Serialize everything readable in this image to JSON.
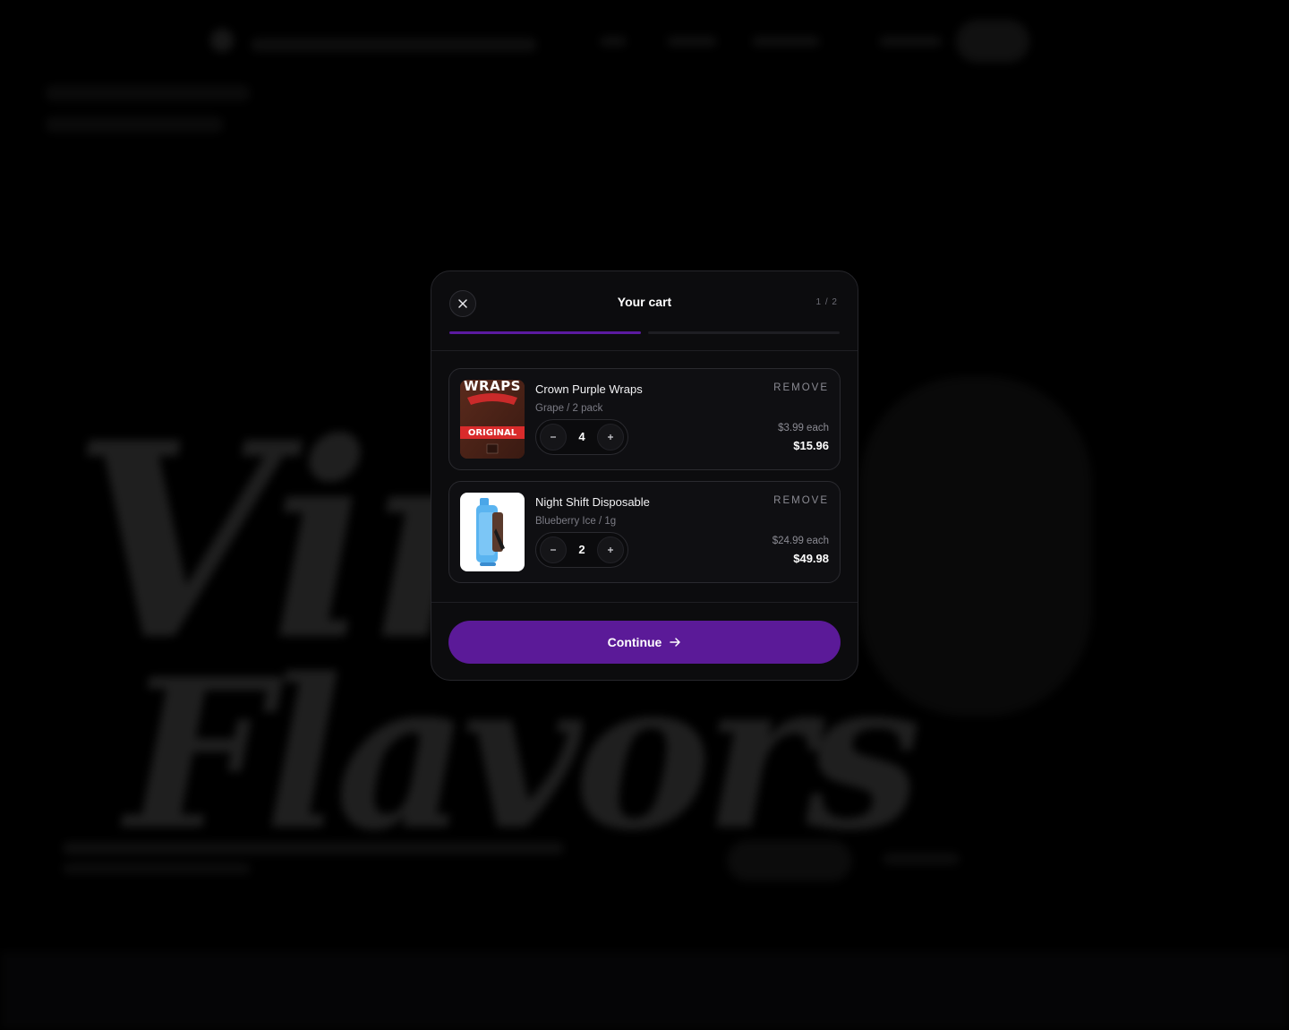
{
  "modal": {
    "title": "Your cart",
    "step": "1 / 2",
    "progress_fraction": 0.5,
    "continue_label": "Continue",
    "accent": "#5b1a98"
  },
  "cart": {
    "items": [
      {
        "name": "Crown Purple Wraps",
        "variant": "Grape / 2 pack",
        "remove_label": "REMOVE",
        "quantity": "4",
        "unit_price": "$3.99 each",
        "line_total": "$15.96",
        "image_text_top": "WRAPS",
        "image_text_band": "ORIGINAL"
      },
      {
        "name": "Night Shift Disposable",
        "variant": "Blueberry Ice / 1g",
        "remove_label": "REMOVE",
        "quantity": "2",
        "unit_price": "$24.99 each",
        "line_total": "$49.98"
      }
    ]
  },
  "icons": {
    "close": "close-icon",
    "minus": "minus-icon",
    "plus": "plus-icon",
    "arrow": "arrow-right-icon"
  }
}
